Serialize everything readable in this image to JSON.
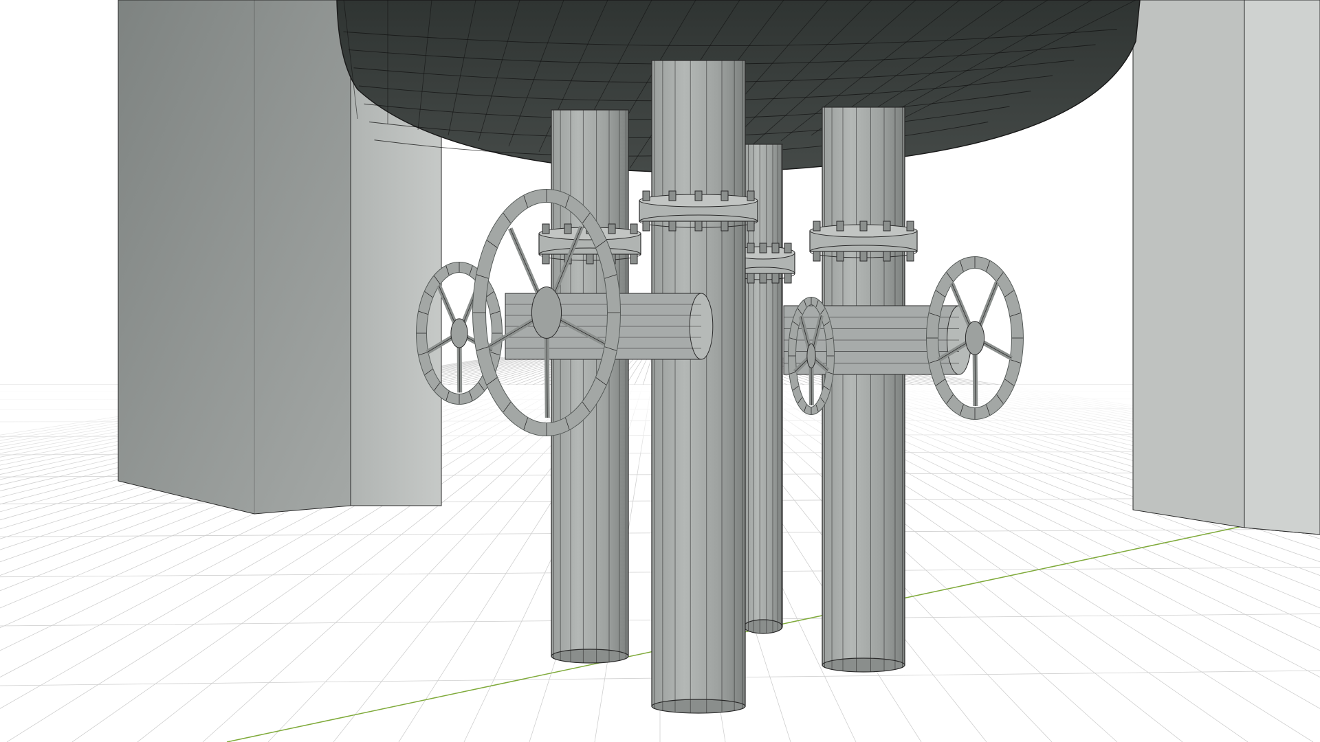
{
  "viewport": {
    "background_color": "#ffffff",
    "grid_line_color": "#cfcfcf",
    "axis_line_color": "#7faa3a",
    "wireframe_color": "#2a2a2a",
    "mesh_light_color": "#a9adab",
    "mesh_mid_color": "#8e9290",
    "mesh_dark_color": "#6f7371",
    "tank_bottom_color": "#3a3f3d",
    "display_mode": "solid-wireframe"
  },
  "scene_objects": [
    "left-block",
    "right-block",
    "tank-bottom",
    "pipe-front-center",
    "pipe-back-left",
    "pipe-back-right",
    "pipe-front-right",
    "valve-handwheel-left-outer",
    "valve-handwheel-left-inner",
    "valve-handwheel-right",
    "valve-handwheel-right-rear",
    "flange-collars"
  ]
}
